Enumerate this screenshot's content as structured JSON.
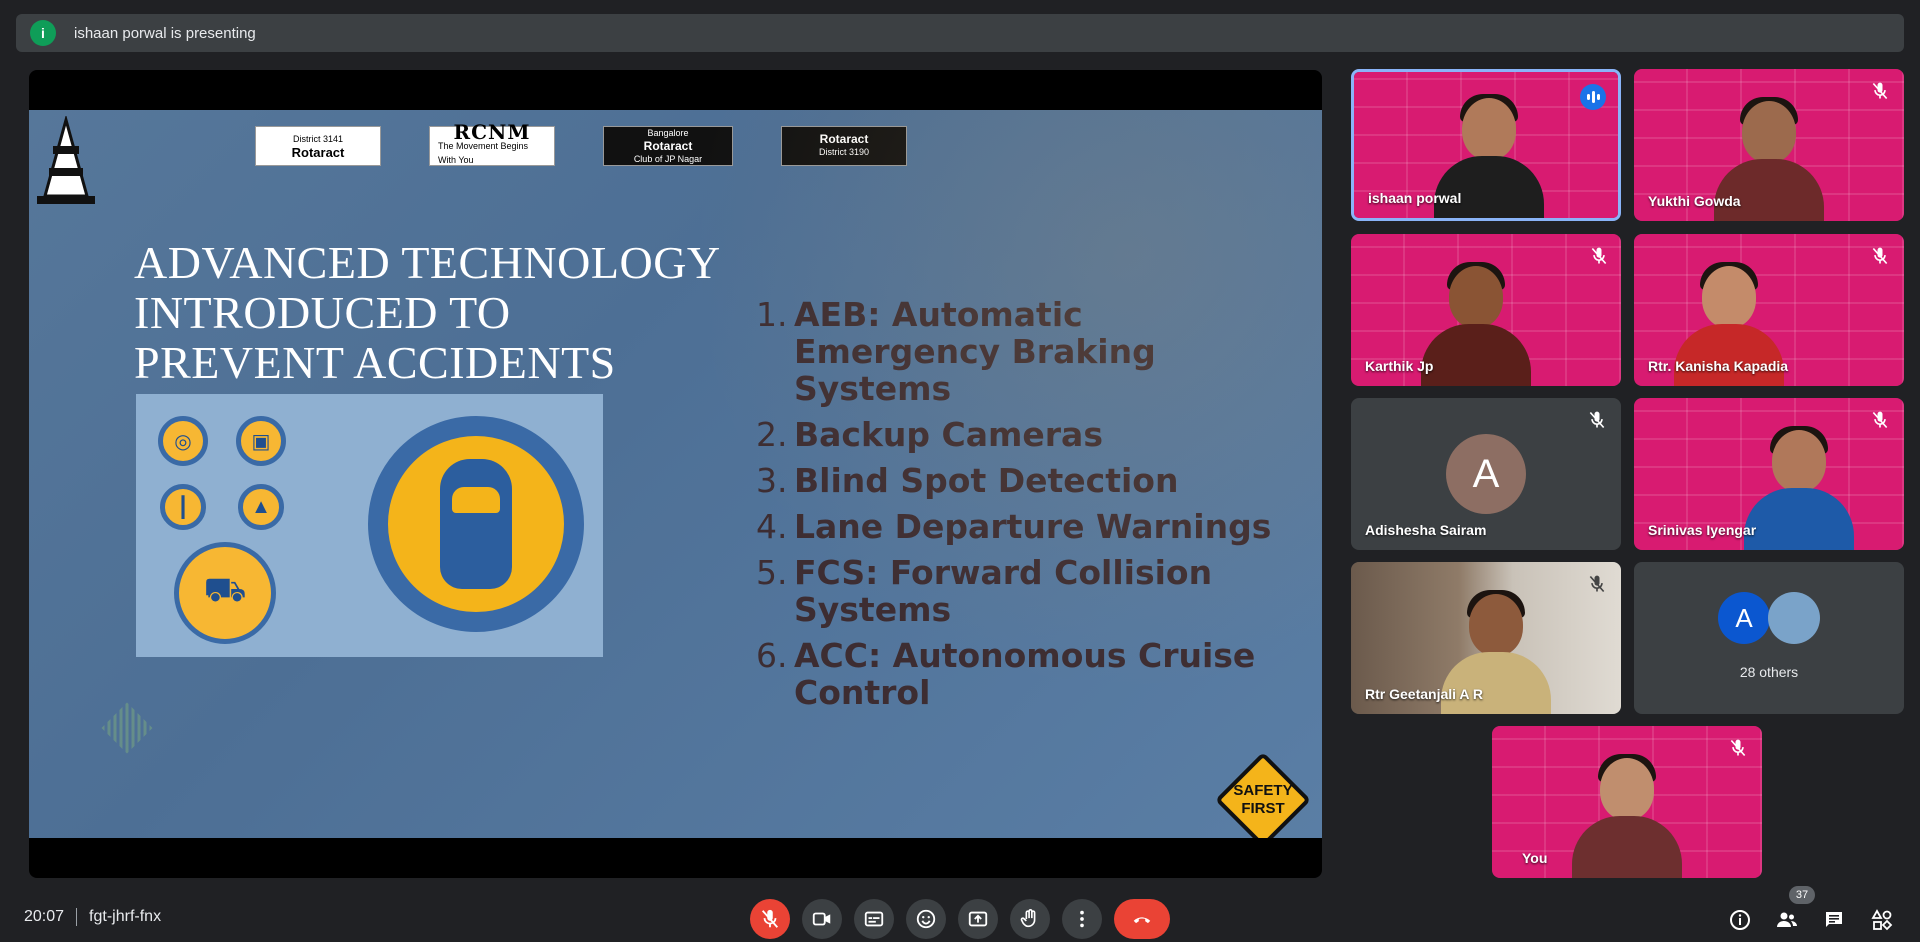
{
  "banner": {
    "badge": "i",
    "text": "ishaan porwal is presenting"
  },
  "slide": {
    "logos": [
      {
        "top": "District 3141",
        "main": "Rotaract"
      },
      {
        "main": "RCNM",
        "sub": "The Movement Begins With You"
      },
      {
        "top": "Bangalore",
        "main": "Rotaract",
        "sub": "Club of JP Nagar"
      },
      {
        "main": "Rotaract",
        "sub": "District 3190"
      }
    ],
    "title_lines": [
      "ADVANCED TECHNOLOGY",
      "INTRODUCED TO",
      "PREVENT ACCIDENTS"
    ],
    "items": [
      {
        "num": "1.",
        "text": "AEB: Automatic Emergency Braking Systems"
      },
      {
        "num": "2.",
        "text": "Backup Cameras"
      },
      {
        "num": "3.",
        "text": "Blind Spot Detection"
      },
      {
        "num": "4.",
        "text": "Lane Departure Warnings"
      },
      {
        "num": "5.",
        "text": "FCS: Forward Collision Systems"
      },
      {
        "num": "6.",
        "text": "ACC: Autonomous Cruise Control"
      }
    ],
    "safety_sign": [
      "SAFETY",
      "FIRST"
    ]
  },
  "participants": [
    {
      "name": "ishaan porwal"
    },
    {
      "name": "Yukthi Gowda"
    },
    {
      "name": "Karthik Jp"
    },
    {
      "name": "Rtr. Kanisha Kapadia"
    },
    {
      "name": "Adishesha Sairam",
      "initial": "A"
    },
    {
      "name": "Srinivas Iyengar"
    },
    {
      "name": "Rtr Geetanjali A R"
    },
    {
      "label": "28 others",
      "initial": "A"
    },
    {
      "name": "You"
    }
  ],
  "meeting": {
    "time": "20:07",
    "code": "fgt-jhrf-fnx"
  },
  "people_count": "37",
  "colors": {
    "accent_blue": "#1a73e8",
    "end_call_red": "#ea4335",
    "background": "#202124"
  }
}
